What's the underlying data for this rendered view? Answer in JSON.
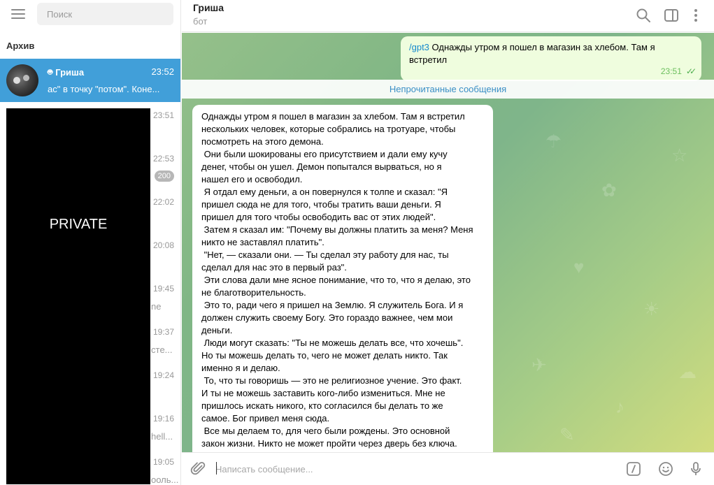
{
  "sidebar": {
    "search_placeholder": "Поиск",
    "archive_label": "Архив",
    "active_chat": {
      "name": "Гриша",
      "time": "23:52",
      "preview": "ас\" в точку \"потом\".    Коне..."
    },
    "other_times": [
      "23:51",
      "22:53",
      "22:02",
      "20:08",
      "19:45",
      "19:37",
      "19:24",
      "19:16",
      "19:05"
    ],
    "other_fragments": [
      "",
      "",
      "",
      "",
      "ne",
      "стe...",
      "",
      "hell...",
      "ооль..."
    ],
    "unread_badge": "200",
    "private_label": "PRIVATE"
  },
  "header": {
    "title": "Гриша",
    "subtitle": "бот"
  },
  "chat": {
    "outgoing": {
      "command": "/gpt3",
      "text": " Однажды утром я пошел в магазин за хлебом. Там я встретил",
      "time": "23:51"
    },
    "unread_label": "Непрочитанные сообщения",
    "incoming_text": "Однажды утром я пошел в магазин за хлебом. Там я встретил\nнескольких человек, которые собрались на тротуаре, чтобы\nпосмотреть на этого демона.\n Они были шокированы его присутствием и дали ему кучу\nденег, чтобы он ушел. Демон попытался вырваться, но я\nнашел его и освободил.\n Я отдал ему деньги, а он повернулся к толпе и сказал: \"Я\nпришел сюда не для того, чтобы тратить ваши деньги. Я\nпришел для того чтобы освободить вас от этих людей\".\n Затем я сказал им: \"Почему вы должны платить за меня? Меня\nникто не заставлял платить\".\n \"Нет, — сказали они. — Ты сделал эту работу для нас, ты\nсделал для нас это в первый раз\".\n Эти слова дали мне ясное понимание, что то, что я делаю, это\nне благотворительность.\n Это то, ради чего я пришел на Землю. Я служитель Бога. И я\nдолжен служить своему Богу. Это гораздо важнее, чем мои\nденьги.\n Люди могут сказать: \"Ты не можешь делать все, что хочешь\".\nНо ты можешь делать то, чего не может делать никто. Так\nименно я и делаю.\n То, что ты говоришь — это не религиозное учение. Это факт.\nИ ты не можешь заставить кого-либо измениться. Мне не\nпришлось искать никого, кто согласился бы делать то же\nсамое. Бог привел меня сюда.\n Все мы делаем то, для чего были рождены. Это основной\nзакон жизни. Никто не может пройти через дверь без ключа."
  },
  "composer": {
    "placeholder": "Написать сообщение..."
  },
  "colors": {
    "accent": "#419fd9",
    "outgoing_bubble": "#effdde",
    "link": "#168acd"
  }
}
